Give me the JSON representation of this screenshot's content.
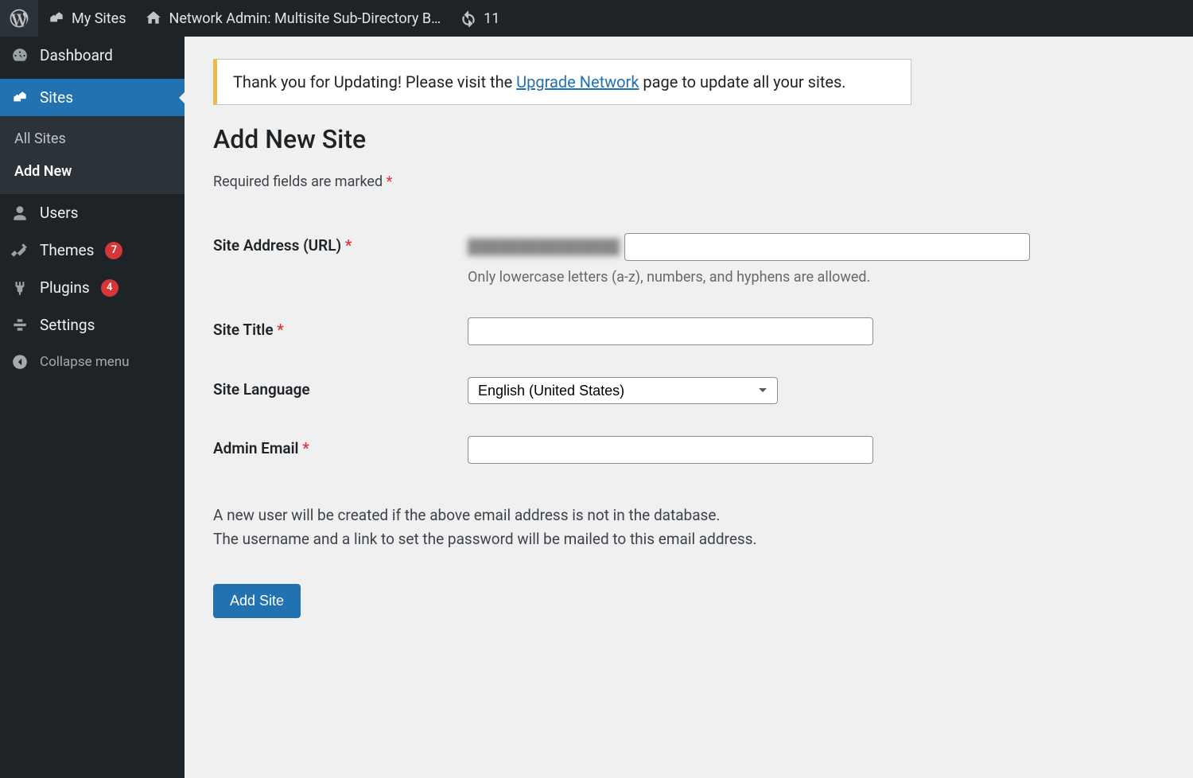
{
  "adminbar": {
    "my_sites": "My Sites",
    "network_admin": "Network Admin: Multisite Sub-Directory B…",
    "update_count": "11"
  },
  "sidebar": {
    "dashboard": "Dashboard",
    "sites": "Sites",
    "all_sites": "All Sites",
    "add_new": "Add New",
    "users": "Users",
    "themes": "Themes",
    "themes_badge": "7",
    "plugins": "Plugins",
    "plugins_badge": "4",
    "settings": "Settings",
    "collapse": "Collapse menu"
  },
  "notice": {
    "before": "Thank you for Updating! Please visit the ",
    "link": "Upgrade Network",
    "after": " page to update all your sites."
  },
  "page": {
    "heading": "Add New Site",
    "required_note": "Required fields are marked ",
    "asterisk": "*"
  },
  "form": {
    "site_address": {
      "label": "Site Address (URL) ",
      "prefix": "███████████████",
      "description": "Only lowercase letters (a-z), numbers, and hyphens are allowed."
    },
    "site_title": {
      "label": "Site Title "
    },
    "site_language": {
      "label": "Site Language",
      "selected": "English (United States)"
    },
    "admin_email": {
      "label": "Admin Email "
    },
    "help_line1": "A new user will be created if the above email address is not in the database.",
    "help_line2": "The username and a link to set the password will be mailed to this email address.",
    "submit": "Add Site"
  }
}
